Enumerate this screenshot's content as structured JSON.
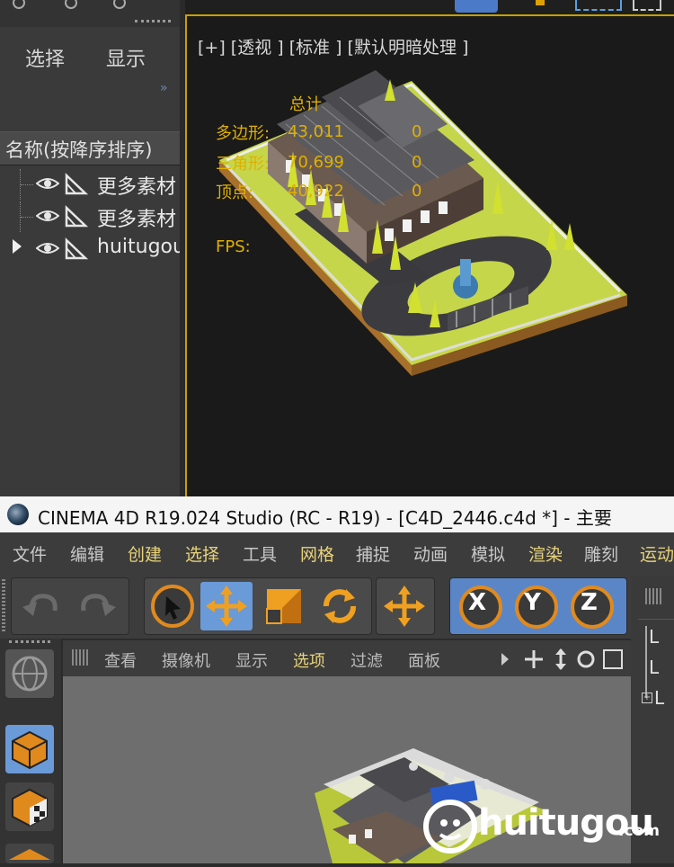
{
  "top_panel": {
    "tabs": [
      "选择",
      "显示"
    ],
    "expand_glyph": "»",
    "column_header": "名称(按降序排序)",
    "objects": [
      {
        "label": "更多素材",
        "expanded": false
      },
      {
        "label": "更多素材",
        "expanded": false
      },
      {
        "label": "huitugou",
        "expanded": true
      }
    ]
  },
  "viewport_top": {
    "menu": "[+]  [透视 ]  [标准 ]  [默认明暗处理 ]",
    "stats_title": "总计",
    "stats": [
      {
        "label": "多边形:",
        "value": "43,011",
        "sel": "0"
      },
      {
        "label": "三角形:",
        "value": "70,699",
        "sel": "0"
      },
      {
        "label": "顶点:",
        "value": "40,922",
        "sel": "0"
      }
    ],
    "fps_label": "FPS:"
  },
  "titlebar": {
    "text": "CINEMA 4D R19.024 Studio (RC - R19) - [C4D_2446.c4d *] - 主要"
  },
  "menubar": {
    "items": [
      {
        "label": "文件",
        "highlight": false
      },
      {
        "label": "编辑",
        "highlight": false
      },
      {
        "label": "创建",
        "highlight": true
      },
      {
        "label": "选择",
        "highlight": true
      },
      {
        "label": "工具",
        "highlight": false
      },
      {
        "label": "网格",
        "highlight": true
      },
      {
        "label": "捕捉",
        "highlight": false
      },
      {
        "label": "动画",
        "highlight": false
      },
      {
        "label": "模拟",
        "highlight": false
      },
      {
        "label": "渲染",
        "highlight": true
      },
      {
        "label": "雕刻",
        "highlight": false
      },
      {
        "label": "运动",
        "highlight": true
      }
    ]
  },
  "toolbar": {
    "axis_x": "X",
    "axis_y": "Y",
    "axis_z": "Z"
  },
  "viewport_bottom": {
    "menu": [
      "查看",
      "摄像机",
      "显示",
      "选项",
      "过滤",
      "面板"
    ],
    "active_menu": "选项"
  },
  "right_panel": {
    "tree_labels": [
      "L",
      "L",
      "L"
    ]
  },
  "watermark": {
    "text": "huitugou",
    "suffix": ".com"
  },
  "colors": {
    "accent_yellow": "#e0b000",
    "viewport_border": "#c8a000",
    "axis_orange": "#e08a1e",
    "menu_highlight": "#e8d27a",
    "menu_normal": "#c8c8c8"
  }
}
